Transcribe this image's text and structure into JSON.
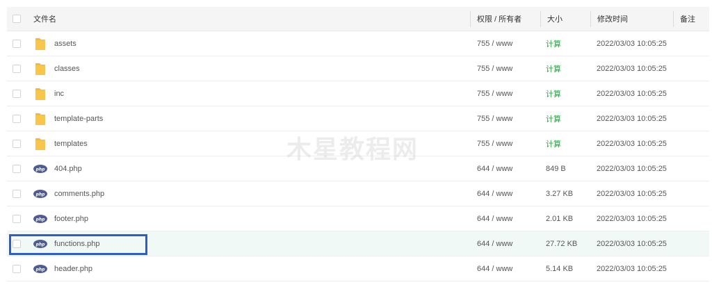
{
  "header": {
    "name": "文件名",
    "perm": "权限 / 所有者",
    "size": "大小",
    "time": "修改时间",
    "note": "备注"
  },
  "files": [
    {
      "name": "assets",
      "type": "folder",
      "perm": "755 / www",
      "size": "计算",
      "time": "2022/03/03 10:05:25"
    },
    {
      "name": "classes",
      "type": "folder",
      "perm": "755 / www",
      "size": "计算",
      "time": "2022/03/03 10:05:25"
    },
    {
      "name": "inc",
      "type": "folder",
      "perm": "755 / www",
      "size": "计算",
      "time": "2022/03/03 10:05:25"
    },
    {
      "name": "template-parts",
      "type": "folder",
      "perm": "755 / www",
      "size": "计算",
      "time": "2022/03/03 10:05:25"
    },
    {
      "name": "templates",
      "type": "folder",
      "perm": "755 / www",
      "size": "计算",
      "time": "2022/03/03 10:05:25"
    },
    {
      "name": "404.php",
      "type": "php",
      "perm": "644 / www",
      "size": "849 B",
      "time": "2022/03/03 10:05:25"
    },
    {
      "name": "comments.php",
      "type": "php",
      "perm": "644 / www",
      "size": "3.27 KB",
      "time": "2022/03/03 10:05:25"
    },
    {
      "name": "footer.php",
      "type": "php",
      "perm": "644 / www",
      "size": "2.01 KB",
      "time": "2022/03/03 10:05:25"
    },
    {
      "name": "functions.php",
      "type": "php",
      "perm": "644 / www",
      "size": "27.72 KB",
      "time": "2022/03/03 10:05:25"
    },
    {
      "name": "header.php",
      "type": "php",
      "perm": "644 / www",
      "size": "5.14 KB",
      "time": "2022/03/03 10:05:25"
    }
  ],
  "php_icon_text": "php",
  "watermark": "木星教程网",
  "colors": {
    "calc": "#20a53a",
    "highlight": "#2d5ec8",
    "folder": "#f7c64a",
    "php": "#4f5b93"
  }
}
